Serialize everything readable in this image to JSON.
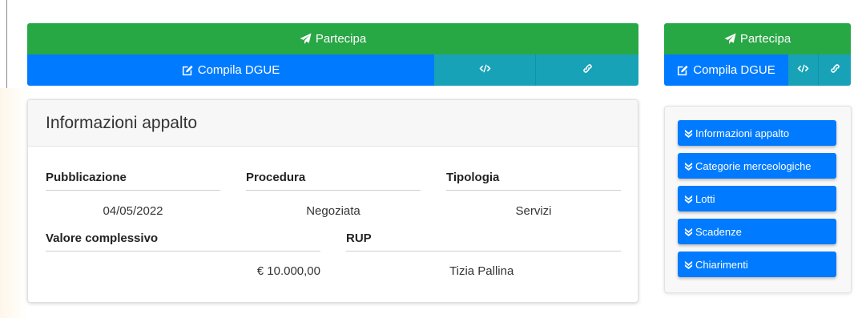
{
  "main_actions": {
    "participate_label": "Partecipa",
    "dgue_label": "Compila DGUE",
    "code_icon": "code-icon",
    "link_icon": "link-icon"
  },
  "side_actions": {
    "participate_label": "Partecipa",
    "dgue_label": "Compila DGUE"
  },
  "info_card": {
    "title": "Informazioni appalto",
    "fields": {
      "pubblicazione": {
        "label": "Pubblicazione",
        "value": "04/05/2022"
      },
      "procedura": {
        "label": "Procedura",
        "value": "Negoziata"
      },
      "tipologia": {
        "label": "Tipologia",
        "value": "Servizi"
      },
      "valore": {
        "label": "Valore complessivo",
        "value": "€ 10.000,00"
      },
      "rup": {
        "label": "RUP",
        "value": "Tizia Pallina"
      }
    }
  },
  "side_nav": {
    "items": [
      {
        "label": "Informazioni appalto"
      },
      {
        "label": "Categorie merceologiche"
      },
      {
        "label": "Lotti"
      },
      {
        "label": "Scadenze"
      },
      {
        "label": "Chiarimenti"
      }
    ]
  },
  "colors": {
    "green": "#28a745",
    "blue": "#007bff",
    "teal": "#17a2b8"
  }
}
